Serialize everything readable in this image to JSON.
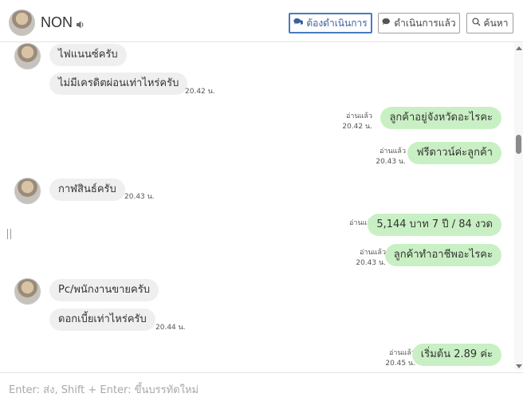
{
  "header": {
    "contact_name": "NON",
    "buttons": {
      "pending": "ต้องดำเนินการ",
      "done": "ดำเนินการแล้ว",
      "search": "ค้นหา"
    }
  },
  "messages": [
    {
      "dir": "in",
      "text": "ไฟแนนซ์ครับ",
      "time": ""
    },
    {
      "dir": "in",
      "text": "ไม่มีเครดิตผ่อนเท่าไหร่ครับ",
      "time": "20.42 น."
    },
    {
      "dir": "out",
      "text": "ลูกค้าอยู่จังหวัดอะไรคะ",
      "read": "อ่านแล้ว",
      "time": "20.42 น."
    },
    {
      "dir": "out",
      "text": "ฟรีดาวน์ค่ะลูกค้า",
      "read": "อ่านแล้ว",
      "time": "20.43 น."
    },
    {
      "dir": "in",
      "text": "กาฬสินธ์ครับ",
      "time": "20.43 น."
    },
    {
      "dir": "out",
      "text": "5,144 บาท  7 ปี / 84 งวด",
      "read": "อ่านแล้ว",
      "time": ""
    },
    {
      "dir": "out",
      "text": "ลูกค้าทำอาชีพอะไรคะ",
      "read": "อ่านแล้ว",
      "time": "20.43 น."
    },
    {
      "dir": "in",
      "text": "Pc/พนักงานขายครับ",
      "time": ""
    },
    {
      "dir": "in",
      "text": "ดอกเบี้ยเท่าไหร่ครับ",
      "time": "20.44 น."
    },
    {
      "dir": "out",
      "text": "เริ่มต้น 2.89 ค่ะ",
      "read": "อ่านแล้ว",
      "time": "20.45 น."
    }
  ],
  "composer": {
    "placeholder": "Enter: ส่ง, Shift + Enter: ขึ้นบรรทัดใหม่"
  },
  "colors": {
    "incoming_bubble": "#efefef",
    "outgoing_bubble": "#c9f0c4",
    "active_button_border": "#4a7ac0"
  }
}
